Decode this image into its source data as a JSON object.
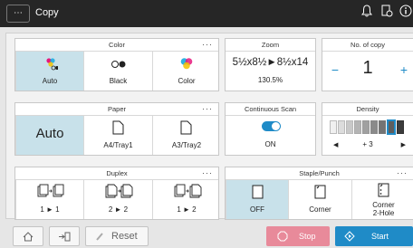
{
  "topbar": {
    "title": "Copy",
    "menu_glyph": "⋯",
    "icons": [
      "bell-icon",
      "document-status-icon",
      "info-icon"
    ]
  },
  "color": {
    "heading": "Color",
    "options": [
      "Auto",
      "Black",
      "Color"
    ],
    "selected": "Auto"
  },
  "zoom": {
    "heading": "Zoom",
    "paper": "5½x8½►8½x14",
    "ratio": "130.5%"
  },
  "copies": {
    "heading": "No. of copy",
    "minus": "−",
    "value": "1",
    "plus": "+"
  },
  "paper": {
    "heading": "Paper",
    "options": [
      "Auto",
      "A4/Tray1",
      "A3/Tray2"
    ],
    "selected": "Auto"
  },
  "continuous_scan": {
    "heading": "Continuous Scan",
    "state": "ON"
  },
  "density": {
    "heading": "Density",
    "value": "+ 3",
    "left_arrow": "◀",
    "right_arrow": "▶"
  },
  "duplex": {
    "heading": "Duplex",
    "options": [
      "1 ► 1",
      "2 ► 2",
      "1 ► 2"
    ]
  },
  "staple": {
    "heading": "Staple/Punch",
    "options": [
      "OFF",
      "Corner",
      "Corner\n2-Hole"
    ],
    "selected": "OFF"
  },
  "bottombar": {
    "reset": "Reset",
    "stop": "Stop",
    "start": "Start"
  },
  "colors": {
    "selected": "#c8e1ea",
    "toggle_on": "#1f8bc7",
    "stop": "#e88a9a",
    "start": "#1f8bc7",
    "topbar": "#262626"
  }
}
